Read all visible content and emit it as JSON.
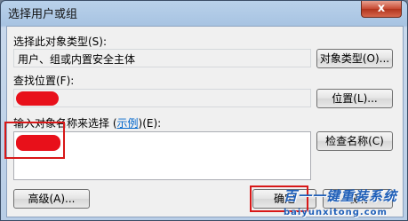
{
  "window": {
    "title": "选择用户或组",
    "close_glyph": "x"
  },
  "object_type": {
    "label": "选择此对象类型(S):",
    "value": "用户、组或内置安全主体",
    "button": "对象类型(O)..."
  },
  "location": {
    "label": "查找位置(F):",
    "button": "位置(L)..."
  },
  "names": {
    "label_prefix": "输入对象名称来选择 (",
    "label_link": "示例",
    "label_suffix": ")(E):",
    "check_button": "检查名称(C)"
  },
  "footer": {
    "advanced_button": "高级(A)...",
    "ok_button": "确定",
    "cancel_button": "取消"
  },
  "watermark": {
    "text": "百一一键重装系统",
    "url": "baiyunxitong.com"
  },
  "colors": {
    "redaction": "#e8101a",
    "annotation": "#d81818",
    "link": "#0066cc"
  }
}
